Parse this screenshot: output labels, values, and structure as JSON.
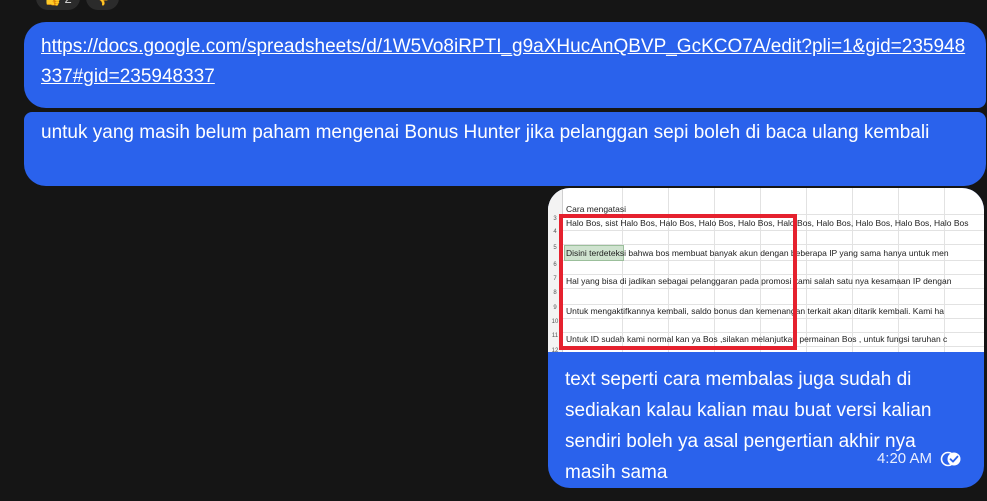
{
  "reactions": [
    {
      "icon": "thumbs-up-icon",
      "glyph": "👍",
      "count": "2"
    },
    {
      "icon": "thumbs-down-icon",
      "glyph": "👎",
      "count": ""
    }
  ],
  "messages": {
    "link": "https://docs.google.com/spreadsheets/d/1W5Vo8iRPTI_g9aXHucAnQBVP_GcKCO7A/edit?pli=1&gid=235948337#gid=235948337",
    "text": "untuk yang masih belum paham mengenai Bonus Hunter jika pelanggan sepi boleh di baca ulang kembali",
    "caption": "text seperti cara membalas juga sudah di sediakan kalau kalian mau buat versi kalian sendiri boleh ya asal pengertian akhir nya masih sama",
    "time": "4:20 AM"
  },
  "sheet": {
    "row_numbers": [
      "3",
      "4",
      "5",
      "6",
      "7",
      "8",
      "9",
      "10",
      "11",
      "12"
    ],
    "rows": [
      "Cara mengatasi",
      "Halo Bos, sist Halo Bos, Halo Bos, Halo Bos, Halo Bos, Halo Bos, Halo Bos, Halo Bos, Halo Bos, Halo Bos",
      "Disini terdeteksi bahwa bos membuat banyak akun dengan beberapa IP yang sama hanya untuk men",
      "Hal yang bisa di jadikan sebagai pelanggaran pada promosi kami salah satu nya kesamaan IP dengan",
      " Untuk mengaktifkannya kembali, saldo bonus dan kemenangan terkait akan ditarik kembali. Kami ha",
      "Untuk ID sudah kami normal kan ya Bos ,silakan melanjutkan permainan Bos , untuk fungsi taruhan c"
    ]
  },
  "colors": {
    "background": "#151515",
    "bubble": "#2a62ec",
    "highlight_box": "#e5212e"
  }
}
